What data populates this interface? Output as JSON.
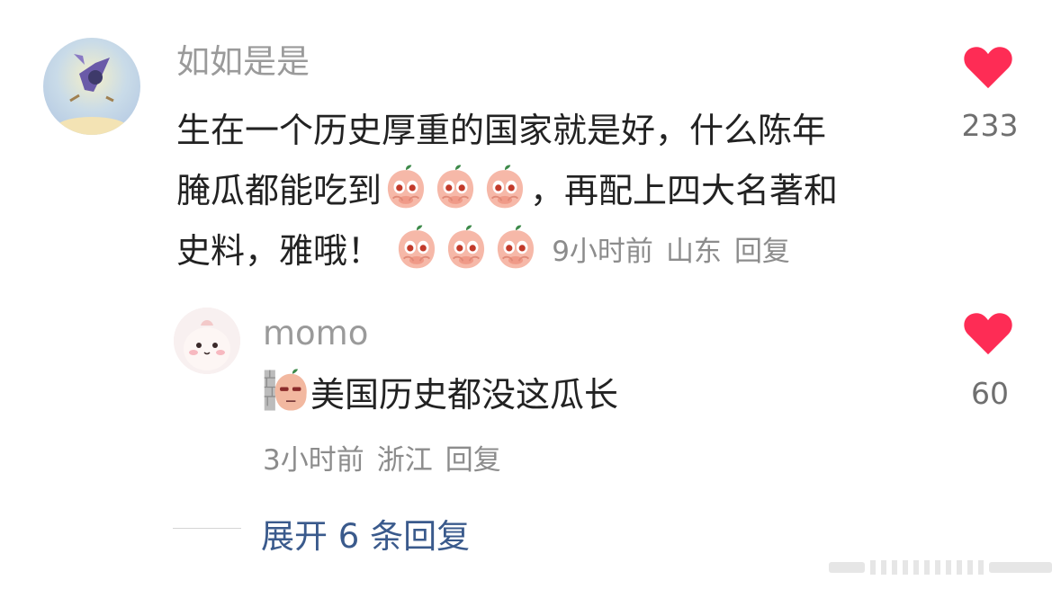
{
  "comment": {
    "username": "如如是是",
    "text_line1": "生在一个历史厚重的国家就是好，什么陈年",
    "text_line2a": "腌瓜都能吃到",
    "text_line2b": "，再配上四大名著和",
    "text_line3": "史料，雅哦！",
    "time": "9小时前",
    "location": "山东",
    "reply_label": "回复",
    "like_count": "233",
    "emoji_name": "peach-cry-emoji"
  },
  "reply": {
    "username": "momo",
    "text": "美国历史都没这瓜长",
    "time": "3小时前",
    "location": "浙江",
    "reply_label": "回复",
    "like_count": "60",
    "emoji_name": "peach-wall-emoji"
  },
  "expand_label": "展开 6 条回复",
  "colors": {
    "like": "#fe2c55",
    "link": "#3a5a8c",
    "muted": "#8c8c8c"
  }
}
